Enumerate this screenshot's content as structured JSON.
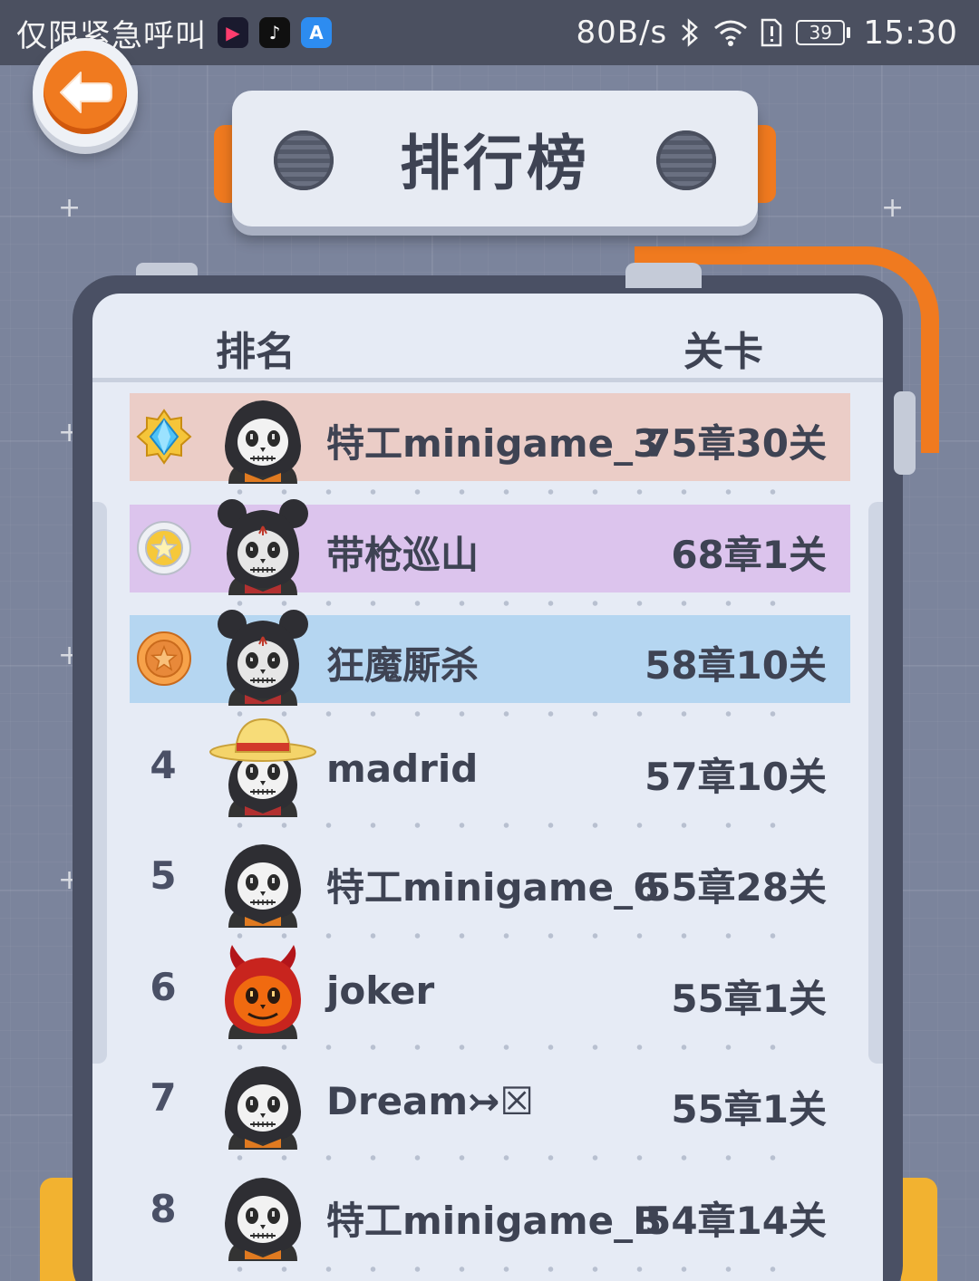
{
  "status_bar": {
    "carrier_text": "仅限紧急呼叫",
    "app_icons": [
      "kuaikan-icon",
      "tiktok-icon",
      "app-store-icon"
    ],
    "net_speed": "80B/s",
    "battery": "39",
    "time": "15:30"
  },
  "title": "排行榜",
  "header": {
    "rank_label": "排名",
    "level_label": "关卡"
  },
  "colors": {
    "accent_orange": "#f07a1f",
    "row_gold": "#ebcdc7",
    "row_silver": "#dcc4ed",
    "row_bronze": "#b5d6f1",
    "board_frame": "#4a5064",
    "board_bg": "#e6ebf5"
  },
  "rows": [
    {
      "rank": "1",
      "medal": "diamond-medal-icon",
      "avatar": "hooded-skull-avatar",
      "name": "特工minigame_3",
      "level": "75章30关"
    },
    {
      "rank": "2",
      "medal": "silver-star-medal-icon",
      "avatar": "mouse-ears-skull-avatar",
      "name": "带枪巡山",
      "level": "68章1关"
    },
    {
      "rank": "3",
      "medal": "bronze-star-medal-icon",
      "avatar": "mouse-ears-skull-avatar",
      "name": "狂魔厮杀",
      "level": "58章10关"
    },
    {
      "rank": "4",
      "medal": "",
      "avatar": "straw-hat-skull-avatar",
      "name": "madrid",
      "level": "57章10关"
    },
    {
      "rank": "5",
      "medal": "",
      "avatar": "hooded-skull-avatar",
      "name": "特工minigame_6",
      "level": "55章28关"
    },
    {
      "rank": "6",
      "medal": "",
      "avatar": "devil-pumpkin-avatar",
      "name": "joker",
      "level": "55章1关"
    },
    {
      "rank": "7",
      "medal": "",
      "avatar": "hooded-skull-avatar",
      "name": "Dream↣☒",
      "level": "55章1关"
    },
    {
      "rank": "8",
      "medal": "",
      "avatar": "hooded-skull-avatar",
      "name": "特工minigame_B",
      "level": "54章14关"
    }
  ]
}
